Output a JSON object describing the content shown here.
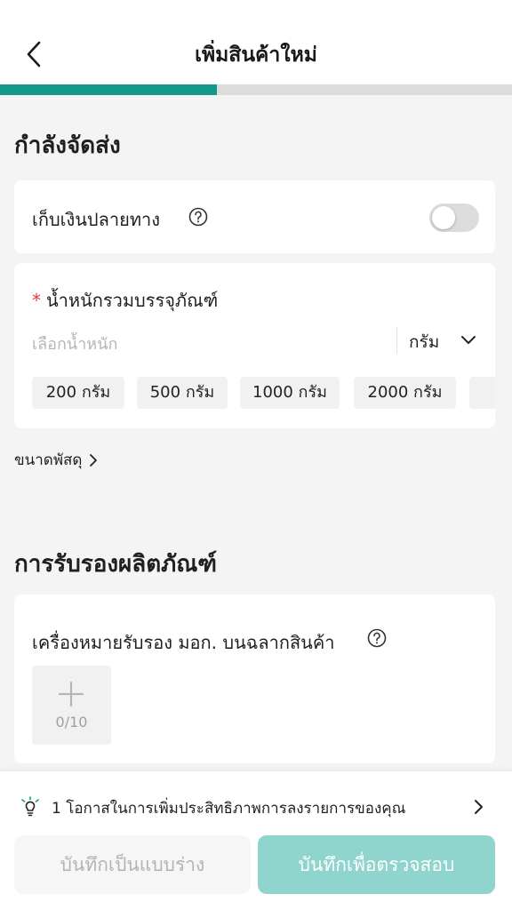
{
  "header": {
    "title": "เพิ่มสินค้าใหม่"
  },
  "progress": {
    "value": 0.424,
    "fill_color": "#14988c",
    "track_color": "#dcdcdc"
  },
  "shipping": {
    "section_title": "กำลังจัดส่ง",
    "cod_label": "เก็บเงินปลายทาง",
    "cod_enabled": false,
    "weight": {
      "required_mark": "*",
      "label": "น้ำหนักรวมบรรจุภัณฑ์",
      "placeholder": "เลือกน้ำหนัก",
      "unit": "กรัม",
      "presets": [
        "200 กรัม",
        "500 กรัม",
        "1000 กรัม",
        "2000 กรัม"
      ]
    },
    "package_size_link": "ขนาดพัสดุ"
  },
  "certification": {
    "section_title": "การรับรองผลิตภัณฑ์",
    "tisi_label": "เครื่องหมายรับรอง มอก. บนฉลากสินค้า",
    "upload_count": "0/10"
  },
  "footer": {
    "tip_text": "1 โอกาสในการเพิ่มประสิทธิภาพการลงรายการของคุณ",
    "draft_button": "บันทึกเป็นแบบร่าง",
    "submit_button": "บันทึกเพื่อตรวจสอบ"
  },
  "icons": {
    "back": "chevron-left-icon",
    "help": "question-circle-icon",
    "unit_dropdown": "chevron-down-icon",
    "link_arrow": "chevron-right-icon",
    "upload": "plus-icon",
    "tip": "lightbulb-icon"
  }
}
